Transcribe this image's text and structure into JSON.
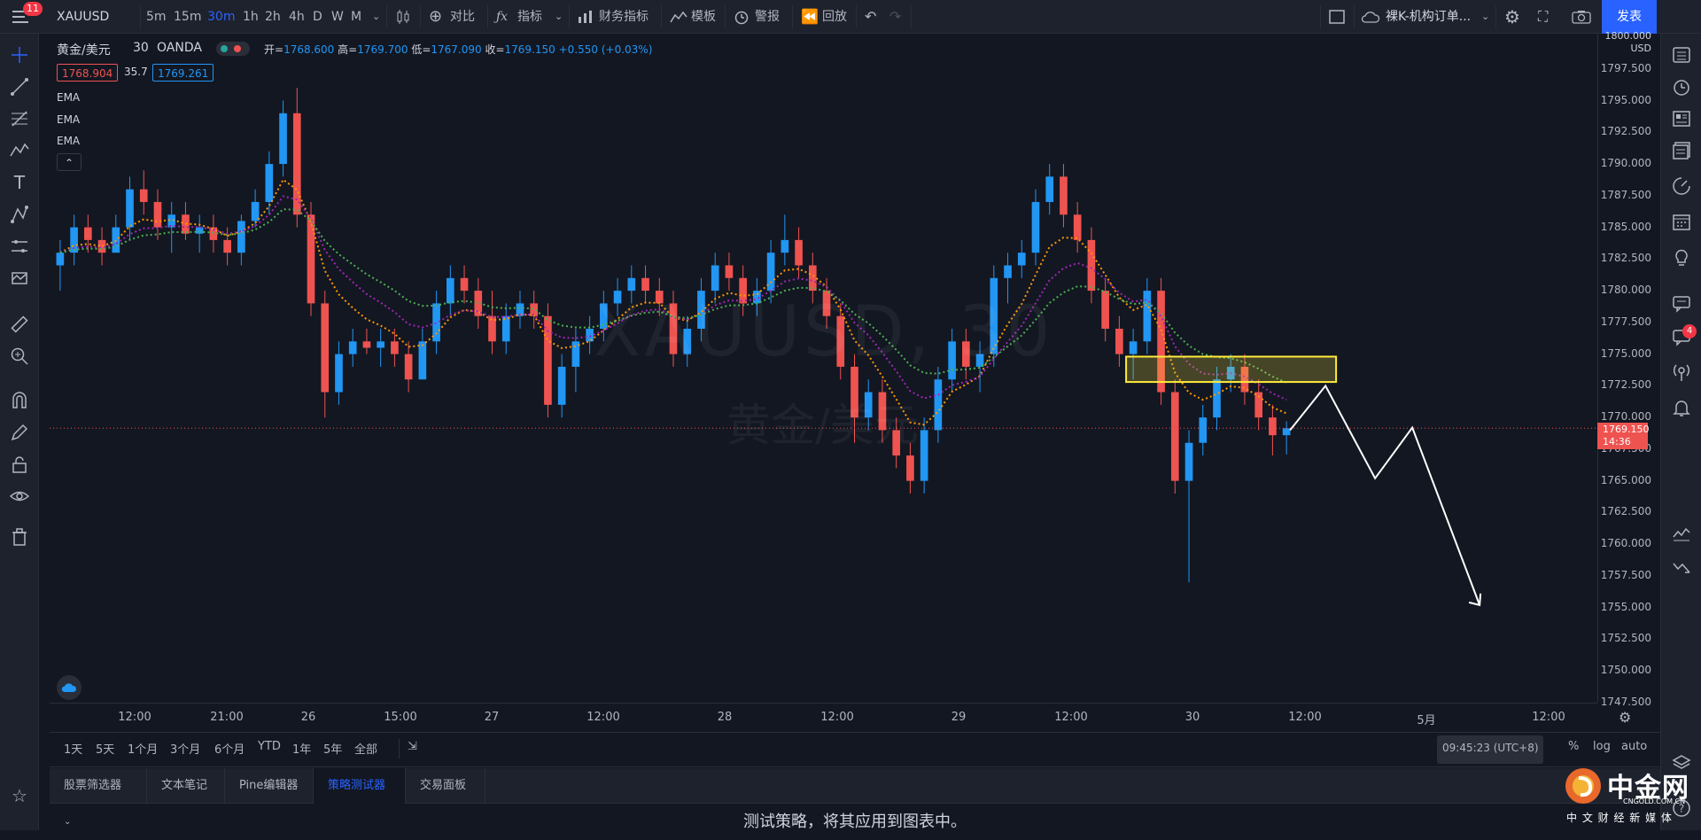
{
  "topbar": {
    "menu_badge": "11",
    "symbol": "XAUUSD",
    "intervals": [
      "5m",
      "15m",
      "30m",
      "1h",
      "2h",
      "4h",
      "D",
      "W",
      "M"
    ],
    "active_interval": "30m",
    "compare_label": "对比",
    "indicators_label": "指标",
    "financials_label": "财务指标",
    "templates_label": "模板",
    "alert_label": "警报",
    "replay_label": "回放",
    "layout_name": "裸K-机构订单...",
    "publish_label": "发表"
  },
  "legend": {
    "title": "黄金/美元",
    "interval": "30",
    "source": "OANDA",
    "open_label": "开=",
    "open": "1768.600",
    "high_label": "高=",
    "high": "1769.700",
    "low_label": "低=",
    "low": "1767.090",
    "close_label": "收=",
    "close": "1769.150",
    "change": "+0.550 (+0.03%)",
    "bid": "1768.904",
    "spread": "35.7",
    "ask": "1769.261",
    "indicators": [
      "EMA",
      "EMA",
      "EMA"
    ]
  },
  "watermark": {
    "symbol": "XAUUSD, 30",
    "name": "黄金/美元"
  },
  "price_scale": {
    "currency_top": "1800.000",
    "currency": "USD",
    "ticks": [
      "1797.500",
      "1795.000",
      "1792.500",
      "1790.000",
      "1787.500",
      "1785.000",
      "1782.500",
      "1780.000",
      "1777.500",
      "1775.000",
      "1772.500",
      "1770.000",
      "1767.500",
      "1765.000",
      "1762.500",
      "1760.000",
      "1757.500",
      "1755.000",
      "1752.500",
      "1750.000",
      "1747.500"
    ],
    "last_price": "1769.150",
    "countdown": "14:36"
  },
  "time_axis": {
    "ticks": [
      "12:00",
      "21:00",
      "26",
      "15:00",
      "27",
      "12:00",
      "28",
      "12:00",
      "29",
      "12:00",
      "30",
      "12:00",
      "5月",
      "12:00"
    ]
  },
  "range_bar": {
    "ranges": [
      "1天",
      "5天",
      "1个月",
      "3个月",
      "6个月",
      "YTD",
      "1年",
      "5年",
      "全部"
    ],
    "clock": "09:45:23 (UTC+8)",
    "percent": "%",
    "log": "log",
    "auto": "auto"
  },
  "bottom_tabs": {
    "tabs": [
      "股票筛选器",
      "文本笔记",
      "Pine编辑器",
      "策略测试器",
      "交易面板"
    ],
    "active": "策略测试器",
    "message": "测试策略，将其应用到图表中。"
  },
  "right_badge": "4",
  "brand": {
    "name": "中金网",
    "domain": "CNGOLD.COM.CN",
    "slogan": "中 文 财 经 新 媒 体"
  },
  "colors": {
    "background": "#131722",
    "up": "#2196f3",
    "down": "#ef5350",
    "accent": "#2962ff",
    "zone": "#ffeb3b"
  },
  "chart_data": {
    "type": "candlestick",
    "ylim": [
      1747.5,
      1800
    ],
    "candles": [
      [
        1782,
        1784,
        1780,
        1783
      ],
      [
        1783,
        1786,
        1782,
        1785
      ],
      [
        1785,
        1786,
        1783,
        1784
      ],
      [
        1784,
        1785,
        1782,
        1783
      ],
      [
        1783,
        1786,
        1783,
        1785
      ],
      [
        1785,
        1789,
        1784,
        1788
      ],
      [
        1788,
        1789.5,
        1786,
        1787
      ],
      [
        1787,
        1788,
        1784,
        1785
      ],
      [
        1785,
        1787,
        1783,
        1786
      ],
      [
        1786,
        1787,
        1784,
        1784.5
      ],
      [
        1784.5,
        1786,
        1783,
        1785
      ],
      [
        1785,
        1786,
        1783,
        1784
      ],
      [
        1784,
        1785,
        1782,
        1783
      ],
      [
        1783,
        1786,
        1782,
        1785.5
      ],
      [
        1785.5,
        1788,
        1785,
        1787
      ],
      [
        1787,
        1791,
        1786,
        1790
      ],
      [
        1790,
        1795,
        1789,
        1794
      ],
      [
        1794,
        1796,
        1785,
        1786
      ],
      [
        1786,
        1787,
        1778,
        1779
      ],
      [
        1779,
        1780,
        1770,
        1772
      ],
      [
        1772,
        1776,
        1771,
        1775
      ],
      [
        1775,
        1777,
        1774,
        1776
      ],
      [
        1776,
        1777,
        1775,
        1775.5
      ],
      [
        1775.5,
        1777,
        1774,
        1776
      ],
      [
        1776,
        1777,
        1774,
        1775
      ],
      [
        1775,
        1776,
        1772,
        1773
      ],
      [
        1773,
        1777,
        1773,
        1776
      ],
      [
        1776,
        1780,
        1775,
        1779
      ],
      [
        1779,
        1782,
        1778,
        1781
      ],
      [
        1781,
        1782,
        1779,
        1780
      ],
      [
        1780,
        1781,
        1777,
        1778
      ],
      [
        1778,
        1780,
        1775,
        1776
      ],
      [
        1776,
        1779,
        1775,
        1778
      ],
      [
        1778,
        1780,
        1777,
        1779
      ],
      [
        1779,
        1780,
        1777,
        1778
      ],
      [
        1778,
        1779,
        1770,
        1771
      ],
      [
        1771,
        1775,
        1770,
        1774
      ],
      [
        1774,
        1777,
        1772,
        1776
      ],
      [
        1776,
        1778,
        1775,
        1777
      ],
      [
        1777,
        1780,
        1776,
        1779
      ],
      [
        1779,
        1781,
        1778,
        1780
      ],
      [
        1780,
        1782,
        1779,
        1781
      ],
      [
        1781,
        1782,
        1779,
        1780
      ],
      [
        1780,
        1781,
        1778,
        1779
      ],
      [
        1779,
        1780,
        1774,
        1775
      ],
      [
        1775,
        1778,
        1774,
        1777
      ],
      [
        1777,
        1781,
        1776,
        1780
      ],
      [
        1780,
        1783,
        1779,
        1782
      ],
      [
        1782,
        1783,
        1780,
        1781
      ],
      [
        1781,
        1782,
        1778,
        1779
      ],
      [
        1779,
        1781,
        1778,
        1780
      ],
      [
        1780,
        1784,
        1779,
        1783
      ],
      [
        1783,
        1786,
        1782,
        1784
      ],
      [
        1784,
        1785,
        1781,
        1782
      ],
      [
        1782,
        1783,
        1779,
        1780
      ],
      [
        1780,
        1781,
        1777,
        1778
      ],
      [
        1778,
        1779,
        1773,
        1774
      ],
      [
        1774,
        1775,
        1768,
        1770
      ],
      [
        1770,
        1773,
        1769,
        1772
      ],
      [
        1772,
        1773,
        1768,
        1769
      ],
      [
        1769,
        1770,
        1766,
        1767
      ],
      [
        1767,
        1768,
        1764,
        1765
      ],
      [
        1765,
        1770,
        1764,
        1769
      ],
      [
        1769,
        1774,
        1768,
        1773
      ],
      [
        1773,
        1777,
        1772,
        1776
      ],
      [
        1776,
        1777,
        1773,
        1774
      ],
      [
        1774,
        1776,
        1772,
        1775
      ],
      [
        1775,
        1782,
        1774,
        1781
      ],
      [
        1781,
        1783,
        1779,
        1782
      ],
      [
        1782,
        1784,
        1781,
        1783
      ],
      [
        1783,
        1788,
        1782,
        1787
      ],
      [
        1787,
        1790,
        1786,
        1789
      ],
      [
        1789,
        1790,
        1785,
        1786
      ],
      [
        1786,
        1787,
        1783,
        1784
      ],
      [
        1784,
        1785,
        1779,
        1780
      ],
      [
        1780,
        1781,
        1776,
        1777
      ],
      [
        1777,
        1778,
        1774,
        1775
      ],
      [
        1775,
        1777,
        1773,
        1776
      ],
      [
        1776,
        1781,
        1775,
        1780
      ],
      [
        1780,
        1781,
        1771,
        1772
      ],
      [
        1772,
        1773,
        1764,
        1765
      ],
      [
        1765,
        1769,
        1757,
        1768
      ],
      [
        1768,
        1771,
        1767,
        1770
      ],
      [
        1770,
        1774,
        1769,
        1773
      ],
      [
        1773,
        1775,
        1772,
        1774
      ],
      [
        1774,
        1775,
        1771,
        1772
      ],
      [
        1772,
        1773,
        1769,
        1770
      ],
      [
        1770,
        1771,
        1767,
        1768.6
      ],
      [
        1768.6,
        1769.7,
        1767.09,
        1769.15
      ]
    ],
    "ema_colors": [
      "#ff9800",
      "#9c27b0",
      "#4caf50"
    ],
    "annotations": {
      "zone": [
        1772.8,
        1774.8
      ],
      "projection": "zigzag-down"
    }
  }
}
